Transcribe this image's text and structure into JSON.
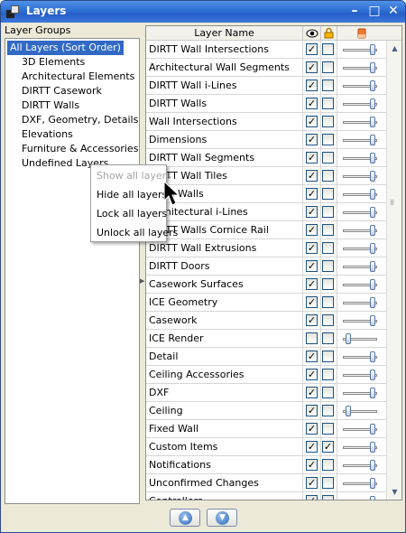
{
  "window": {
    "title": "Layers"
  },
  "groups": {
    "header": "Layer Groups",
    "items": [
      "All Layers (Sort Order)",
      "3D Elements",
      "Architectural Elements",
      "DIRTT Casework",
      "DIRTT Walls",
      "DXF, Geometry, Details",
      "Elevations",
      "Furniture & Accessories",
      "Undefined Layers"
    ]
  },
  "table": {
    "header_name": "Layer Name",
    "visible_icon": "eye-icon",
    "lock_icon": "padlock-icon",
    "transparency_icon": "eraser-icon",
    "rows": [
      {
        "name": "DIRTT Wall Intersections",
        "visible": true,
        "locked": false,
        "opacity": 0.9
      },
      {
        "name": "Architectural Wall Segments",
        "visible": true,
        "locked": false,
        "opacity": 0.9
      },
      {
        "name": "DIRTT Wall i-Lines",
        "visible": true,
        "locked": false,
        "opacity": 0.9
      },
      {
        "name": "DIRTT Walls",
        "visible": true,
        "locked": false,
        "opacity": 0.9
      },
      {
        "name": "Wall Intersections",
        "visible": true,
        "locked": false,
        "opacity": 0.9
      },
      {
        "name": "Dimensions",
        "visible": true,
        "locked": false,
        "opacity": 0.9
      },
      {
        "name": "DIRTT Wall Segments",
        "visible": true,
        "locked": false,
        "opacity": 0.9
      },
      {
        "name": "DIRTT Wall Tiles",
        "visible": true,
        "locked": false,
        "opacity": 0.9
      },
      {
        "name": "Fixed Walls",
        "visible": true,
        "locked": false,
        "opacity": 0.9
      },
      {
        "name": "Architectural i-Lines",
        "visible": true,
        "locked": false,
        "opacity": 0.9
      },
      {
        "name": "DIRTT Walls Cornice Rail",
        "visible": true,
        "locked": false,
        "opacity": 0.9
      },
      {
        "name": "DIRTT Wall Extrusions",
        "visible": true,
        "locked": false,
        "opacity": 0.9
      },
      {
        "name": "DIRTT Doors",
        "visible": true,
        "locked": false,
        "opacity": 0.9
      },
      {
        "name": "Casework Surfaces",
        "visible": true,
        "locked": false,
        "opacity": 0.9
      },
      {
        "name": "ICE Geometry",
        "visible": true,
        "locked": false,
        "opacity": 0.9
      },
      {
        "name": "Casework",
        "visible": true,
        "locked": false,
        "opacity": 0.9
      },
      {
        "name": "ICE Render",
        "visible": false,
        "locked": false,
        "opacity": 0.05
      },
      {
        "name": "Detail",
        "visible": true,
        "locked": false,
        "opacity": 0.9
      },
      {
        "name": "Ceiling Accessories",
        "visible": true,
        "locked": false,
        "opacity": 0.9
      },
      {
        "name": "DXF",
        "visible": true,
        "locked": false,
        "opacity": 0.9
      },
      {
        "name": "Ceiling",
        "visible": true,
        "locked": false,
        "opacity": 0.05
      },
      {
        "name": "Fixed Wall",
        "visible": true,
        "locked": false,
        "opacity": 0.9
      },
      {
        "name": "Custom Items",
        "visible": true,
        "locked": true,
        "opacity": 0.9
      },
      {
        "name": "Notifications",
        "visible": true,
        "locked": false,
        "opacity": 0.9
      },
      {
        "name": "Unconfirmed Changes",
        "visible": true,
        "locked": false,
        "opacity": 0.9
      },
      {
        "name": "Controllers",
        "visible": true,
        "locked": false,
        "opacity": 0.9
      }
    ]
  },
  "context_menu": {
    "items": [
      {
        "label": "Show all layers",
        "enabled": false
      },
      {
        "label": "Hide all layers",
        "enabled": true
      },
      {
        "label": "Lock all layers",
        "enabled": true
      },
      {
        "label": "Unlock all layers",
        "enabled": true
      }
    ]
  },
  "buttons": {
    "move_up_icon": "arrow-up-icon",
    "move_down_icon": "arrow-down-icon"
  }
}
